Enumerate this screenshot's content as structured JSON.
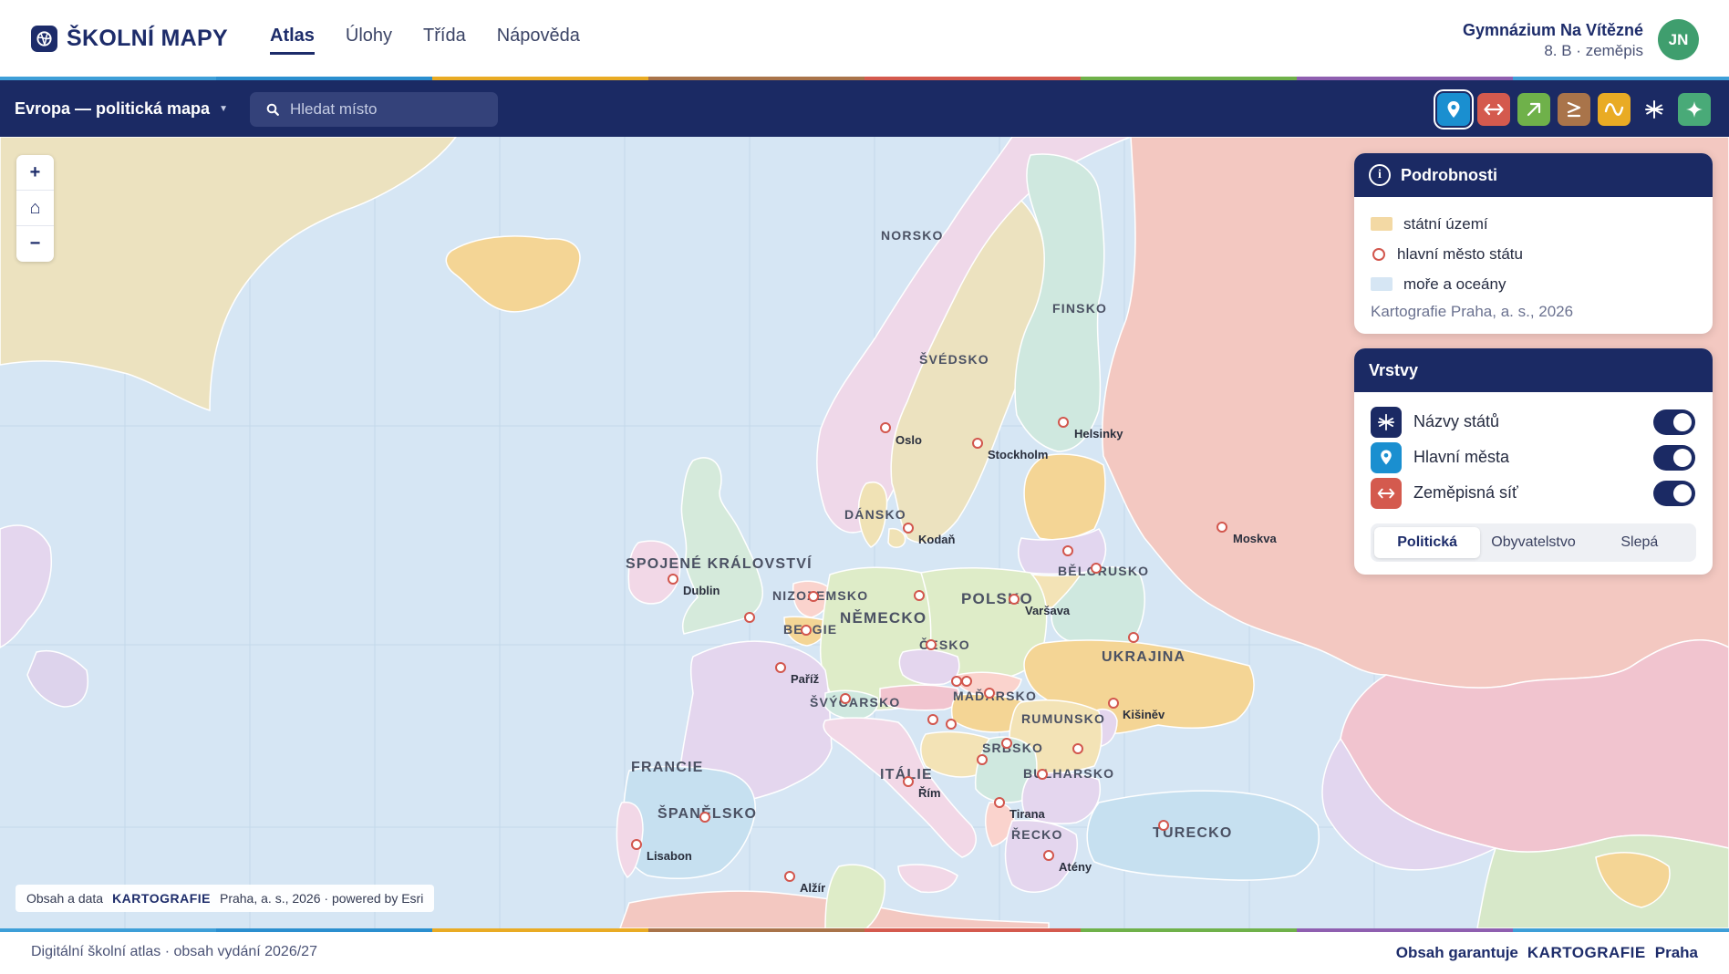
{
  "app": {
    "logo_text": "ŠKOLNÍ MAPY",
    "nav": [
      {
        "label": "Atlas",
        "active": true
      },
      {
        "label": "Úlohy"
      },
      {
        "label": "Třída"
      },
      {
        "label": "Nápověda"
      }
    ],
    "school_name": "Gymnázium Na Vítězné",
    "school_class": "8. B · zeměpis",
    "avatar_initials": "JN"
  },
  "toolbar": {
    "map_title": "Evropa — politická mapa",
    "search_placeholder": "Hledat místo",
    "tools": [
      {
        "name": "pin-tool",
        "color": "#1a8fd0",
        "selected": true
      },
      {
        "name": "arrows-tool",
        "color": "#d45a4e"
      },
      {
        "name": "arrow-up-right-tool",
        "color": "#6fb14a"
      },
      {
        "name": "greater-equal-tool",
        "color": "#a9744a"
      },
      {
        "name": "wave-tool",
        "color": "#e9ab24"
      },
      {
        "name": "asterisk-tool",
        "color": "none"
      },
      {
        "name": "sparkle-tool",
        "color": "#49aa78"
      }
    ]
  },
  "map": {
    "zoom_in": "+",
    "zoom_home": "⌂",
    "zoom_out": "−",
    "countries": [
      "NORSKO",
      "FINSKO",
      "ŠVÉDSKO",
      "DÁNSKO",
      "SPOJENÉ KRÁLOVSTVÍ",
      "NIZOZEMSKO",
      "BELGIE",
      "NĚMECKO",
      "POLSKO",
      "BĚLORUSKO",
      "ČESKO",
      "UKRAJINA",
      "ŠVÝCARSKO",
      "MAĎARSKO",
      "RUMUNSKO",
      "FRANCIE",
      "ITÁLIE",
      "SRBSKO",
      "BULHARSKO",
      "ŠPANĚLSKO",
      "ŘECKO",
      "TURECKO"
    ],
    "cities": [
      "Oslo",
      "Stockholm",
      "Helsinky",
      "Moskva",
      "Kodaň",
      "Dublin",
      "Varšava",
      "Paříž",
      "Kišiněv",
      "Řím",
      "Tirana",
      "Lisabon",
      "Atény",
      "Alžír"
    ],
    "attribution_prefix": "Obsah a data",
    "attribution_brand": "KARTOGRAFIE",
    "attribution_suffix": "Praha, a. s., 2026 · powered by Esri"
  },
  "details_panel": {
    "title": "Podrobnosti",
    "legend": [
      {
        "label": "státní území",
        "color": "#f3d9a4"
      },
      {
        "label": "hlavní město státu",
        "color": "#d2564d"
      },
      {
        "label": "moře a oceány",
        "color": "#d6e6f4"
      }
    ],
    "source": "Kartografie Praha, a. s., 2026"
  },
  "layers_panel": {
    "title": "Vrstvy",
    "layers": [
      {
        "label": "Názvy států",
        "icon": "asterisk-icon",
        "color": "#1b2a64",
        "on": true
      },
      {
        "label": "Hlavní města",
        "icon": "pin-icon",
        "color": "#1a8fd0",
        "on": true
      },
      {
        "label": "Zeměpisná síť",
        "icon": "arrows-icon",
        "color": "#d45a4e",
        "on": true
      }
    ],
    "modes": [
      {
        "label": "Politická",
        "active": true
      },
      {
        "label": "Obyvatelstvo"
      },
      {
        "label": "Slepá"
      }
    ]
  },
  "footer": {
    "left": "Digitální školní atlas · obsah vydání 2026/27",
    "right_prefix": "Obsah garantuje",
    "right_brand": "KARTOGRAFIE",
    "right_suffix": "Praha"
  },
  "colors": {
    "navy": "#1b2a64",
    "sea": "#d6e6f4",
    "capital": "#d2564d",
    "stripe": [
      "#3e9fd8",
      "#2b8fcf",
      "#e9ab24",
      "#a9744a",
      "#d45a4e",
      "#6fb14a"
    ]
  }
}
